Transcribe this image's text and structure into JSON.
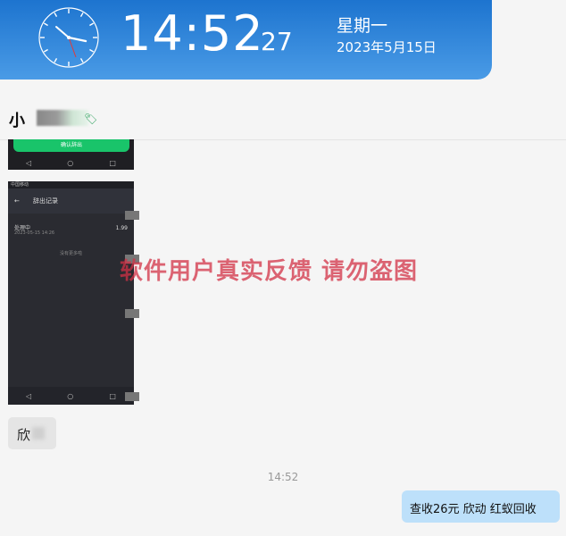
{
  "clock": {
    "time": "14:52",
    "seconds": "27",
    "weekday": "星期一",
    "date": "2023年5月15日"
  },
  "chat": {
    "contact_name": "小",
    "contact_tag": "🏷",
    "timestamp": "14:52",
    "incoming_message": "欣",
    "outgoing_message": "查收26元   欣动  红蚁回收"
  },
  "screenshot_top": {
    "button_label": "确认辞出"
  },
  "screenshot_main": {
    "status_bar": "中国移动",
    "title": "辞出记录",
    "row_title": "处理中",
    "row_date": "2023-05-15 14:26",
    "row_amount": "1.99",
    "empty_hint": "没有更多啦"
  },
  "watermark": "软件用户真实反馈  请勿盗图",
  "colors": {
    "banner_top": "#1d74cf",
    "banner_bottom": "#4a9be6",
    "outgoing_bubble": "#bde0fa",
    "watermark": "#d23246"
  }
}
